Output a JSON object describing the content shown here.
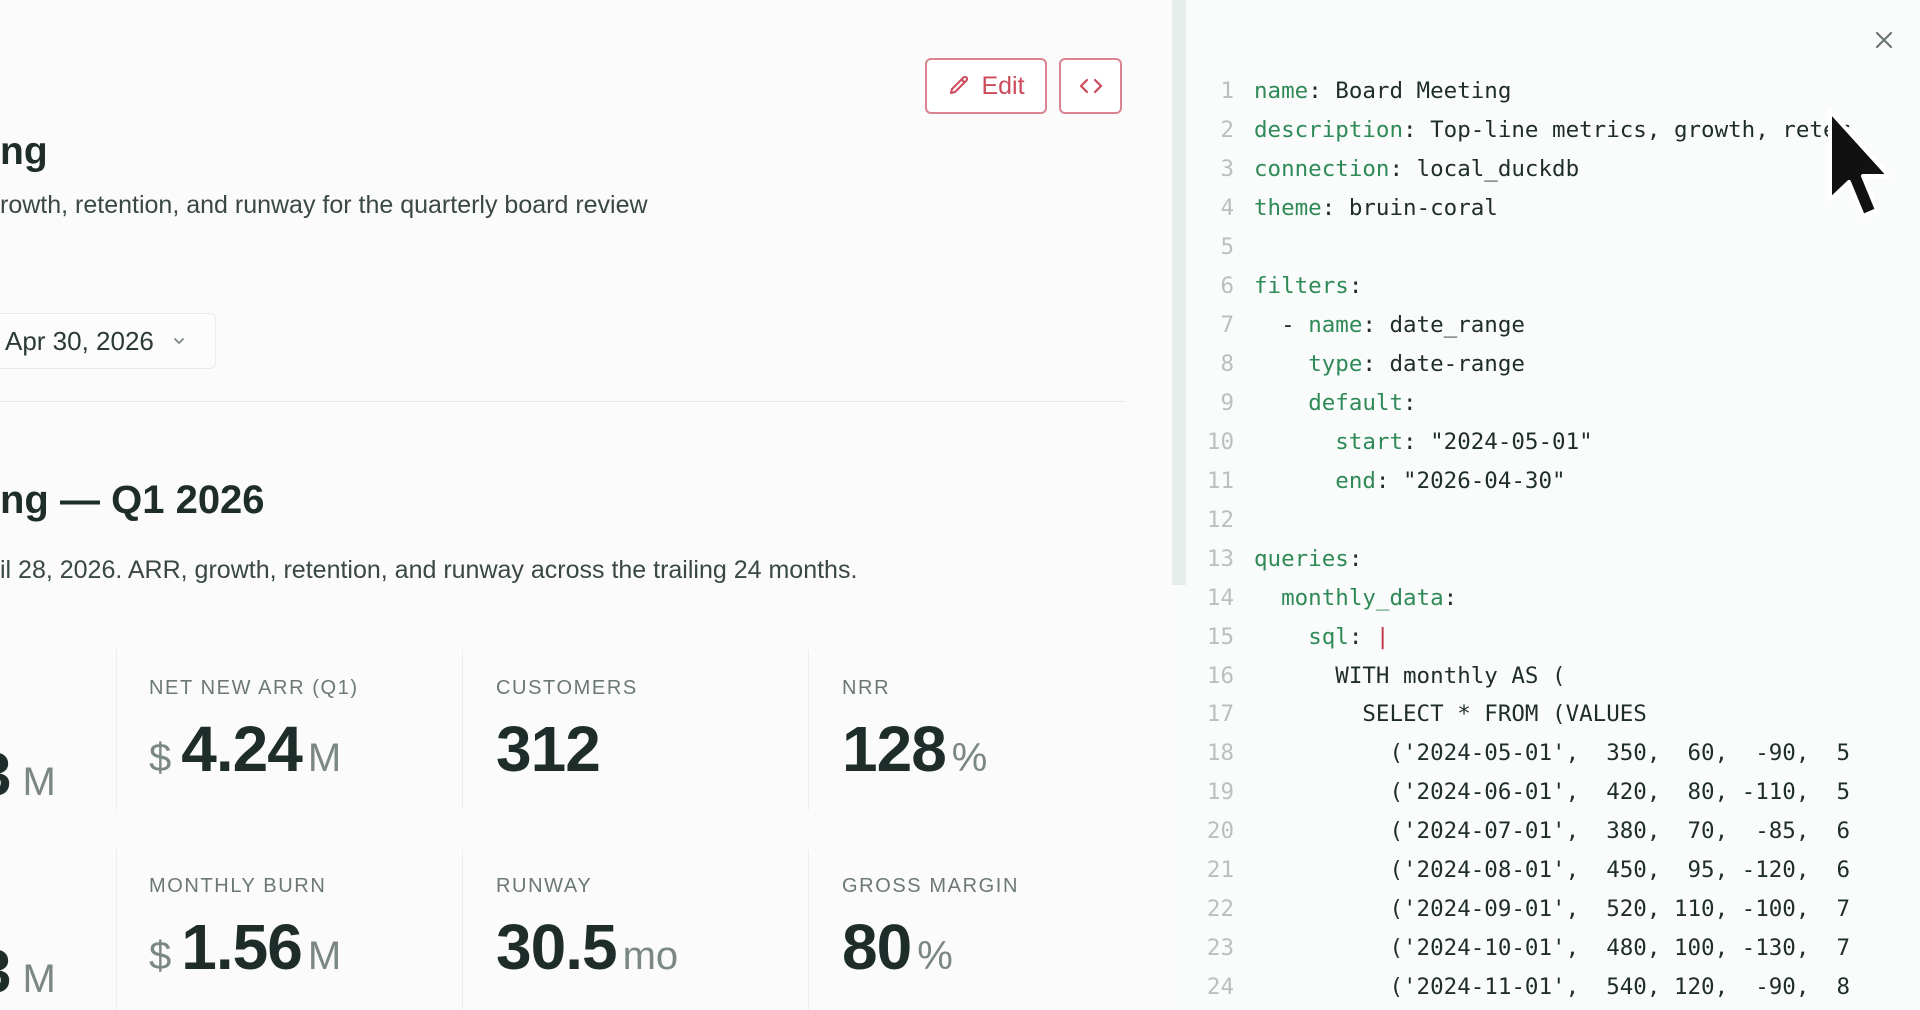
{
  "toolbar": {
    "edit_label": "Edit"
  },
  "dashboard": {
    "title": "ng",
    "description": "rowth, retention, and runway for the quarterly board review",
    "date_range": {
      "end_value": "Apr 30, 2026"
    },
    "section": {
      "title": "ng — Q1 2026",
      "description": "il 28, 2026. ARR, growth, retention, and runway across the trailing 24 months."
    },
    "kpis_row1": {
      "cut_suffix": "M",
      "net_new_arr": {
        "label": "NET NEW ARR (Q1)",
        "prefix": "$",
        "value": "4.24",
        "suffix": "M"
      },
      "customers": {
        "label": "CUSTOMERS",
        "value": "312"
      },
      "nrr": {
        "label": "NRR",
        "value": "128",
        "suffix": "%"
      }
    },
    "kpis_row2": {
      "cut_suffix": "M",
      "monthly_burn": {
        "label": "MONTHLY BURN",
        "prefix": "$",
        "value": "1.56",
        "suffix": "M"
      },
      "runway": {
        "label": "RUNWAY",
        "value": "30.5",
        "suffix": "mo"
      },
      "gross_margin": {
        "label": "GROSS MARGIN",
        "value": "80",
        "suffix": "%"
      }
    }
  },
  "yaml_panel": {
    "lines": [
      {
        "n": "1",
        "indent": "",
        "key": "name",
        "rest": ": Board Meeting"
      },
      {
        "n": "2",
        "indent": "",
        "key": "description",
        "rest": ": Top-line metrics, growth, reter"
      },
      {
        "n": "3",
        "indent": "",
        "key": "connection",
        "rest": ": local_duckdb"
      },
      {
        "n": "4",
        "indent": "",
        "key": "theme",
        "rest": ": bruin-coral"
      },
      {
        "n": "5",
        "indent": "",
        "key": "",
        "rest": ""
      },
      {
        "n": "6",
        "indent": "",
        "key": "filters",
        "rest": ":"
      },
      {
        "n": "7",
        "indent": "  - ",
        "key": "name",
        "rest": ": date_range"
      },
      {
        "n": "8",
        "indent": "    ",
        "key": "type",
        "rest": ": date-range"
      },
      {
        "n": "9",
        "indent": "    ",
        "key": "default",
        "rest": ":"
      },
      {
        "n": "10",
        "indent": "      ",
        "key": "start",
        "rest": ": \"2024-05-01\""
      },
      {
        "n": "11",
        "indent": "      ",
        "key": "end",
        "rest": ": \"2026-04-30\""
      },
      {
        "n": "12",
        "indent": "",
        "key": "",
        "rest": ""
      },
      {
        "n": "13",
        "indent": "",
        "key": "queries",
        "rest": ":"
      },
      {
        "n": "14",
        "indent": "  ",
        "key": "monthly_data",
        "rest": ":"
      },
      {
        "n": "15",
        "indent": "    ",
        "key": "sql",
        "rest": ": ",
        "pipe": "|"
      },
      {
        "n": "16",
        "indent": "      ",
        "key": "",
        "rest": "WITH monthly AS ("
      },
      {
        "n": "17",
        "indent": "        ",
        "key": "",
        "rest": "SELECT * FROM (VALUES"
      },
      {
        "n": "18",
        "indent": "          ",
        "key": "",
        "rest": "('2024-05-01',  350,  60,  -90,  5"
      },
      {
        "n": "19",
        "indent": "          ",
        "key": "",
        "rest": "('2024-06-01',  420,  80, -110,  5"
      },
      {
        "n": "20",
        "indent": "          ",
        "key": "",
        "rest": "('2024-07-01',  380,  70,  -85,  6"
      },
      {
        "n": "21",
        "indent": "          ",
        "key": "",
        "rest": "('2024-08-01',  450,  95, -120,  6"
      },
      {
        "n": "22",
        "indent": "          ",
        "key": "",
        "rest": "('2024-09-01',  520, 110, -100,  7"
      },
      {
        "n": "23",
        "indent": "          ",
        "key": "",
        "rest": "('2024-10-01',  480, 100, -130,  7"
      },
      {
        "n": "24",
        "indent": "          ",
        "key": "",
        "rest": "('2024-11-01',  540, 120,  -90,  8"
      }
    ]
  }
}
